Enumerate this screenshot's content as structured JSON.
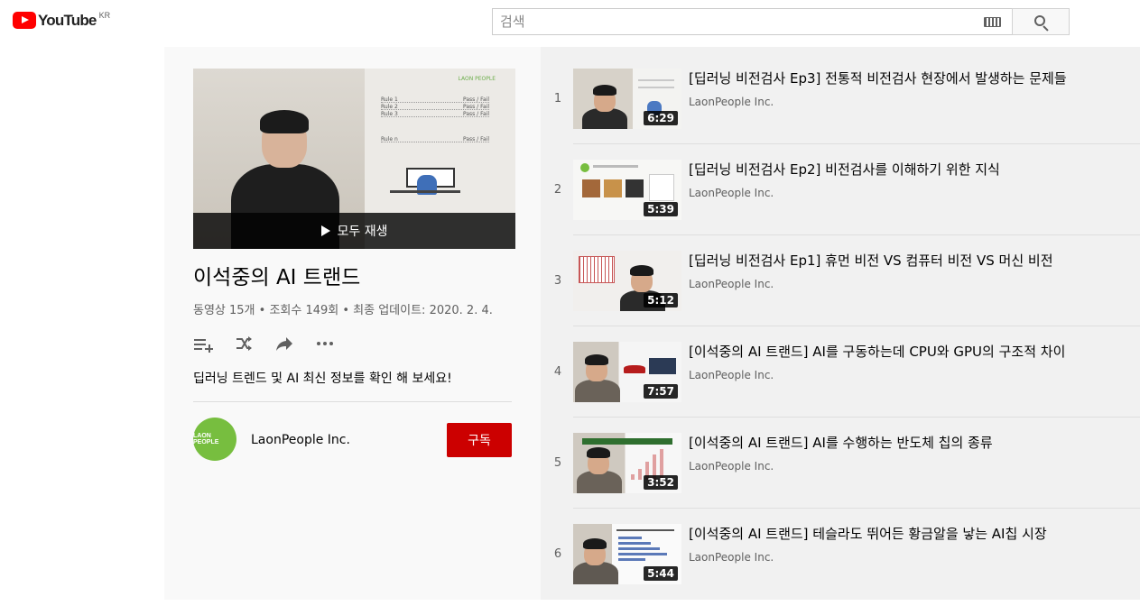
{
  "header": {
    "logo_text": "YouTube",
    "region": "KR",
    "search_placeholder": "검색",
    "keyboard_icon": "keyboard-icon",
    "search_icon": "search-icon"
  },
  "playlist": {
    "play_all_label": "모두 재생",
    "title": "이석중의 AI 트랜드",
    "stats": "동영상 15개 • 조회수 149회 • 최종 업데이트: 2020. 2. 4.",
    "description": "딥러닝 트렌드 및 AI 최신 정보를 확인 해 보세요!",
    "hero_logo": "LAON PEOPLE",
    "hero_rules": [
      {
        "rule": "Rule 1",
        "result": "Pass / Fail"
      },
      {
        "rule": "Rule 2",
        "result": "Pass / Fail"
      },
      {
        "rule": "Rule 3",
        "result": "Pass / Fail"
      },
      {
        "rule": "Rule n",
        "result": "Pass / Fail"
      }
    ],
    "actions": [
      {
        "name": "add-to-queue-icon"
      },
      {
        "name": "shuffle-icon"
      },
      {
        "name": "share-icon"
      },
      {
        "name": "more-icon"
      }
    ],
    "channel": {
      "avatar_text": "LAON PEOPLE",
      "name": "LaonPeople Inc.",
      "subscribe_label": "구독"
    }
  },
  "videos": [
    {
      "index": "1",
      "title": "[딥러닝 비전검사 Ep3] 전통적 비전검사 현장에서 발생하는 문제들",
      "channel": "LaonPeople Inc.",
      "duration": "6:29"
    },
    {
      "index": "2",
      "title": "[딥러닝 비전검사 Ep2] 비전검사를 이해하기 위한 지식",
      "channel": "LaonPeople Inc.",
      "duration": "5:39"
    },
    {
      "index": "3",
      "title": "[딥러닝 비전검사 Ep1] 휴먼 비전 VS 컴퓨터 비전 VS 머신 비전",
      "channel": "LaonPeople Inc.",
      "duration": "5:12"
    },
    {
      "index": "4",
      "title": "[이석중의 AI 트랜드] AI를 구동하는데 CPU와 GPU의 구조적 차이",
      "channel": "LaonPeople Inc.",
      "duration": "7:57"
    },
    {
      "index": "5",
      "title": "[이석중의 AI 트랜드] AI를 수행하는 반도체 칩의 종류",
      "channel": "LaonPeople Inc.",
      "duration": "3:52"
    },
    {
      "index": "6",
      "title": "[이석중의 AI 트랜드] 테슬라도 뛰어든 황금알을 낳는 AI칩 시장",
      "channel": "LaonPeople Inc.",
      "duration": "5:44"
    }
  ],
  "colors": {
    "brand_red": "#ff0000",
    "subscribe_red": "#cc0000",
    "avatar_green": "#77be3f"
  }
}
